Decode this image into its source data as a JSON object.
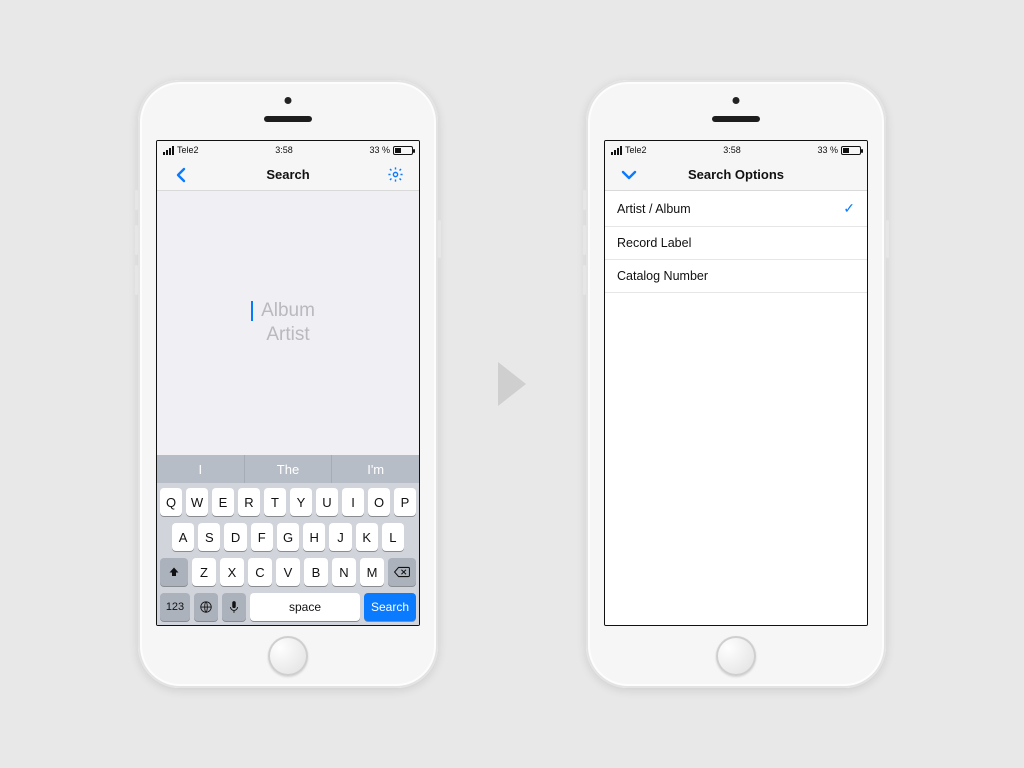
{
  "status": {
    "carrier": "Tele2",
    "time": "3:58",
    "battery_pct": "33 %"
  },
  "left": {
    "nav_title": "Search",
    "inputs": {
      "album_placeholder": "Album",
      "artist_placeholder": "Artist"
    },
    "predictions": [
      "I",
      "The",
      "I'm"
    ],
    "keyboard": {
      "row1": [
        "Q",
        "W",
        "E",
        "R",
        "T",
        "Y",
        "U",
        "I",
        "O",
        "P"
      ],
      "row2": [
        "A",
        "S",
        "D",
        "F",
        "G",
        "H",
        "J",
        "K",
        "L"
      ],
      "row3": [
        "Z",
        "X",
        "C",
        "V",
        "B",
        "N",
        "M"
      ],
      "numbers_label": "123",
      "space_label": "space",
      "action_label": "Search"
    }
  },
  "right": {
    "nav_title": "Search Options",
    "options": [
      {
        "label": "Artist / Album",
        "selected": true
      },
      {
        "label": "Record Label",
        "selected": false
      },
      {
        "label": "Catalog Number",
        "selected": false
      }
    ]
  }
}
